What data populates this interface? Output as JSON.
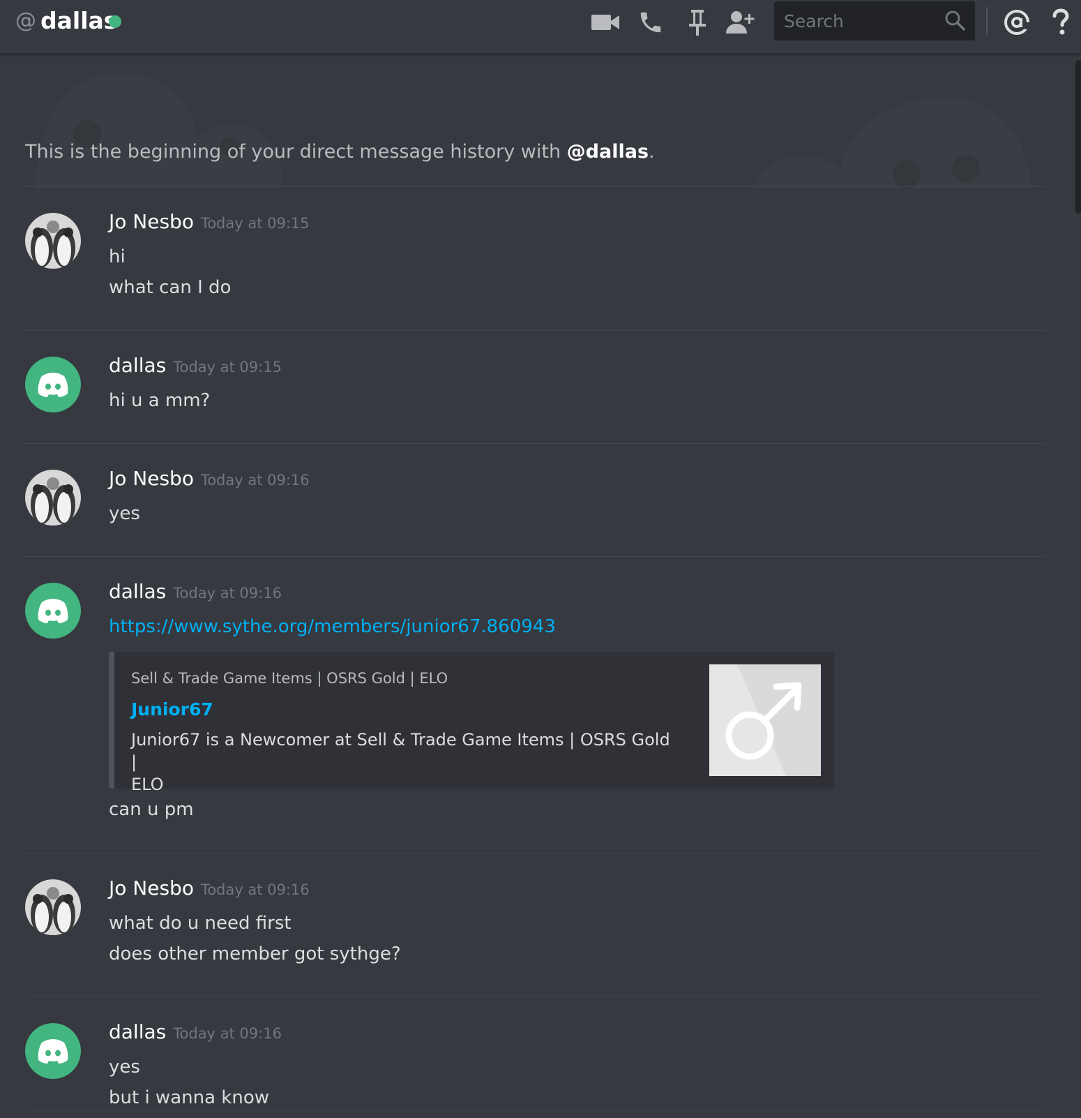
{
  "header": {
    "at": "@",
    "username": "dallas",
    "status_color": "#43b581",
    "icons": [
      "video-camera-icon",
      "phone-icon",
      "pin-icon",
      "add-friend-icon",
      "mention-icon",
      "help-icon"
    ],
    "search_placeholder": "Search"
  },
  "intro": {
    "prefix": "This is the beginning of your direct message history with ",
    "mention": "@dallas",
    "suffix": "."
  },
  "messages": [
    {
      "author": "Jo Nesbo",
      "timestamp": "Today at 09:15",
      "avatar": "penguin-avatar",
      "lines": [
        "hi",
        "what can I do"
      ]
    },
    {
      "author": "dallas",
      "timestamp": "Today at 09:15",
      "avatar": "discord-avatar",
      "lines": [
        "hi u a mm?"
      ]
    },
    {
      "author": "Jo Nesbo",
      "timestamp": "Today at 09:16",
      "avatar": "penguin-avatar",
      "lines": [
        "yes"
      ]
    },
    {
      "author": "dallas",
      "timestamp": "Today at 09:16",
      "avatar": "discord-avatar",
      "link": "https://www.sythe.org/members/junior67.860943",
      "embed": {
        "provider": "Sell & Trade Game Items | OSRS Gold | ELO",
        "title": "Junior67",
        "description_line1": "Junior67 is a Newcomer at Sell & Trade Game Items | OSRS Gold |",
        "description_line2": "ELO",
        "thumbnail_icon": "male-symbol-icon"
      },
      "lines": [
        "can u pm"
      ]
    },
    {
      "author": "Jo Nesbo",
      "timestamp": "Today at 09:16",
      "avatar": "penguin-avatar",
      "lines": [
        "what do u need first",
        "does other member got sythge?"
      ]
    },
    {
      "author": "dallas",
      "timestamp": "Today at 09:16",
      "avatar": "discord-avatar",
      "lines": [
        "yes",
        "but i wanna know"
      ]
    }
  ],
  "colors": {
    "background": "#36393f",
    "discord_green": "#43b581",
    "link": "#00b0f4"
  }
}
